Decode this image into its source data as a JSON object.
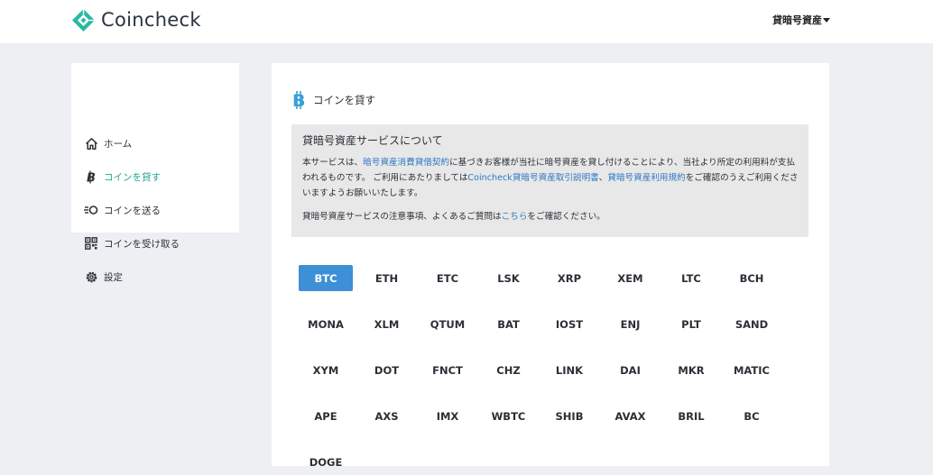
{
  "header": {
    "brand": "Coincheck",
    "account_menu": "貸暗号資産",
    "brand_color": "#2bb9a1"
  },
  "sidebar": {
    "items": [
      {
        "label": "ホーム",
        "icon": "home-icon",
        "active": false
      },
      {
        "label": "コインを貸す",
        "icon": "bitcoin-icon",
        "active": true
      },
      {
        "label": "コインを送る",
        "icon": "send-coin-icon",
        "active": false
      },
      {
        "label": "コインを受け取る",
        "icon": "qr-code-icon",
        "active": false
      },
      {
        "label": "設定",
        "icon": "gear-icon",
        "active": false
      }
    ],
    "active_color": "#22a491"
  },
  "main": {
    "title": "コインを貸す",
    "notice": {
      "title": "貸暗号資産サービスについて",
      "p1_a": "本サービスは、",
      "p1_link1": "暗号資産消費貸借契約",
      "p1_b": "に基づきお客様が当社に暗号資産を貸し付けることにより、当社より所定の利用料が支払われるものです。 ご利用にあたりましては",
      "p1_link2": "Coincheck貸暗号資産取引説明書",
      "p1_c": "、",
      "p1_link3": "貸暗号資産利用規約",
      "p1_d": "をご確認のうえご利用くださいますようお願いいたします。",
      "p2_a": "貸暗号資産サービスの注意事項、よくあるご質問は",
      "p2_link": "こちら",
      "p2_b": "をご確認ください。"
    },
    "coins": [
      "BTC",
      "ETH",
      "ETC",
      "LSK",
      "XRP",
      "XEM",
      "LTC",
      "BCH",
      "MONA",
      "XLM",
      "QTUM",
      "BAT",
      "IOST",
      "ENJ",
      "PLT",
      "SAND",
      "XYM",
      "DOT",
      "FNCT",
      "CHZ",
      "LINK",
      "DAI",
      "MKR",
      "MATIC",
      "APE",
      "AXS",
      "IMX",
      "WBTC",
      "SHIB",
      "AVAX",
      "BRIL",
      "BC",
      "DOGE"
    ],
    "selected_coin": "BTC",
    "selected_color": "#3d8fd6",
    "link_color": "#2f78c4",
    "bitcoin_icon_color": "#3a9fd8"
  }
}
